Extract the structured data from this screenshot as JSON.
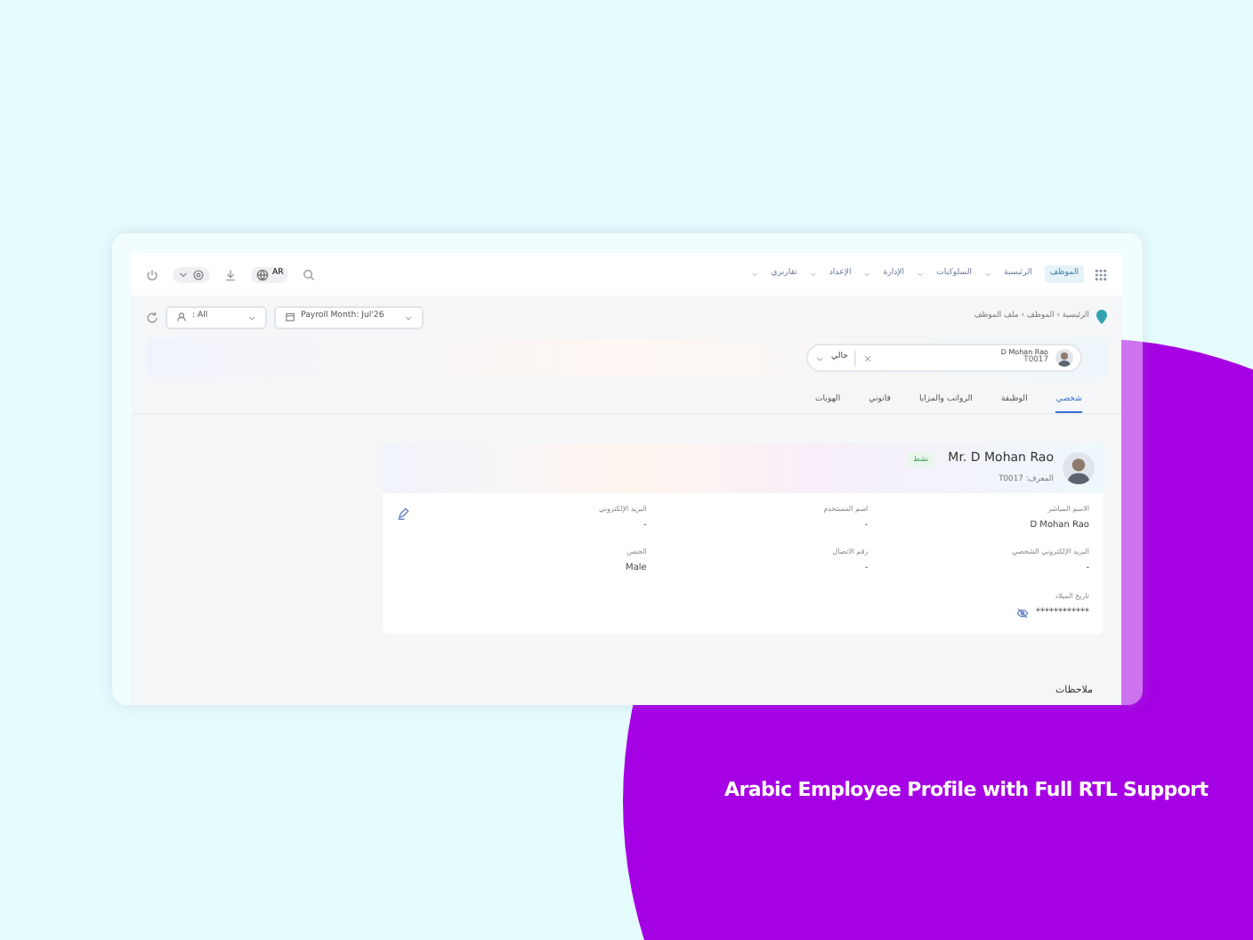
{
  "topbar": {
    "nav": [
      {
        "label": "الموظف",
        "selected": true
      },
      {
        "label": "الرئيسية",
        "selected": false
      },
      {
        "label": "السلوكيات",
        "selected": false
      },
      {
        "label": "الإدارة",
        "selected": false
      },
      {
        "label": "الإعداد",
        "selected": false
      },
      {
        "label": "تقاريري",
        "selected": false
      }
    ],
    "language": "AR"
  },
  "filters": {
    "employee": ": All",
    "payroll_month": "Payroll Month: Jul'26"
  },
  "breadcrumb": "الرئيسية › الموظف › ملف الموظف",
  "search": {
    "name": "D Mohan Rao",
    "id": "T0017",
    "status": "حالي"
  },
  "tabs": [
    {
      "label": "شخصي",
      "selected": true
    },
    {
      "label": "الوظيفة",
      "selected": false
    },
    {
      "label": "الرواتب والمزايا",
      "selected": false
    },
    {
      "label": "قانوني",
      "selected": false
    },
    {
      "label": "الهويات",
      "selected": false
    }
  ],
  "profile": {
    "name": "Mr. D Mohan Rao",
    "status_badge": "نشط",
    "id_line": "المعرف: T0017",
    "fields": [
      {
        "label": "الاسم المباشر",
        "value": "D Mohan Rao",
        "kind": "text"
      },
      {
        "label": "اسم المستخدم",
        "value": "-",
        "kind": "text"
      },
      {
        "label": "البريد الإلكتروني",
        "value": "-",
        "kind": "text"
      },
      {
        "label": "البريد الإلكتروني الشخصي",
        "value": "-",
        "kind": "text"
      },
      {
        "label": "رقم الاتصال",
        "value": "-",
        "kind": "text"
      },
      {
        "label": "الجنس",
        "value": "Male",
        "kind": "text"
      },
      {
        "label": "تاريخ الميلاد",
        "value": "************",
        "kind": "masked"
      }
    ]
  },
  "notes_label": "ملاحظات",
  "caption": "Arabic Employee Profile with Full RTL Support"
}
